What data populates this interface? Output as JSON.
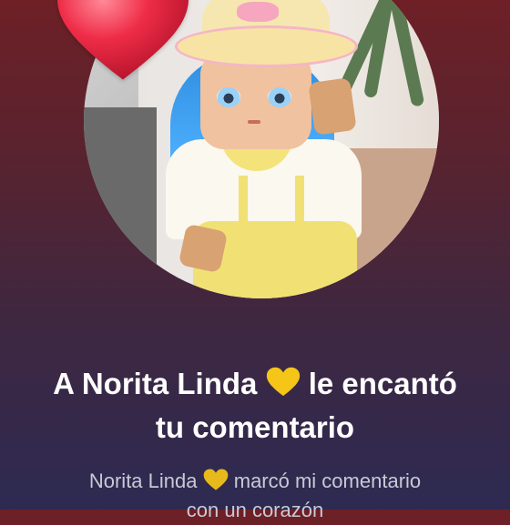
{
  "notification": {
    "user_name": "Norita Linda",
    "headline_prefix": "A Norita Linda",
    "headline_mid": "le encantó",
    "headline_line2": "tu comentario",
    "subtext_prefix": "Norita Linda",
    "subtext_line1": "marcó mi comentario",
    "subtext_line2": "con un corazón"
  },
  "icons": {
    "reaction": "red-heart-icon",
    "name_badge": "yellow-heart-icon"
  },
  "colors": {
    "heart_red": "#e8283f",
    "heart_yellow": "#f5c518",
    "text_primary": "#ffffff",
    "text_secondary": "#c9c9d6"
  }
}
